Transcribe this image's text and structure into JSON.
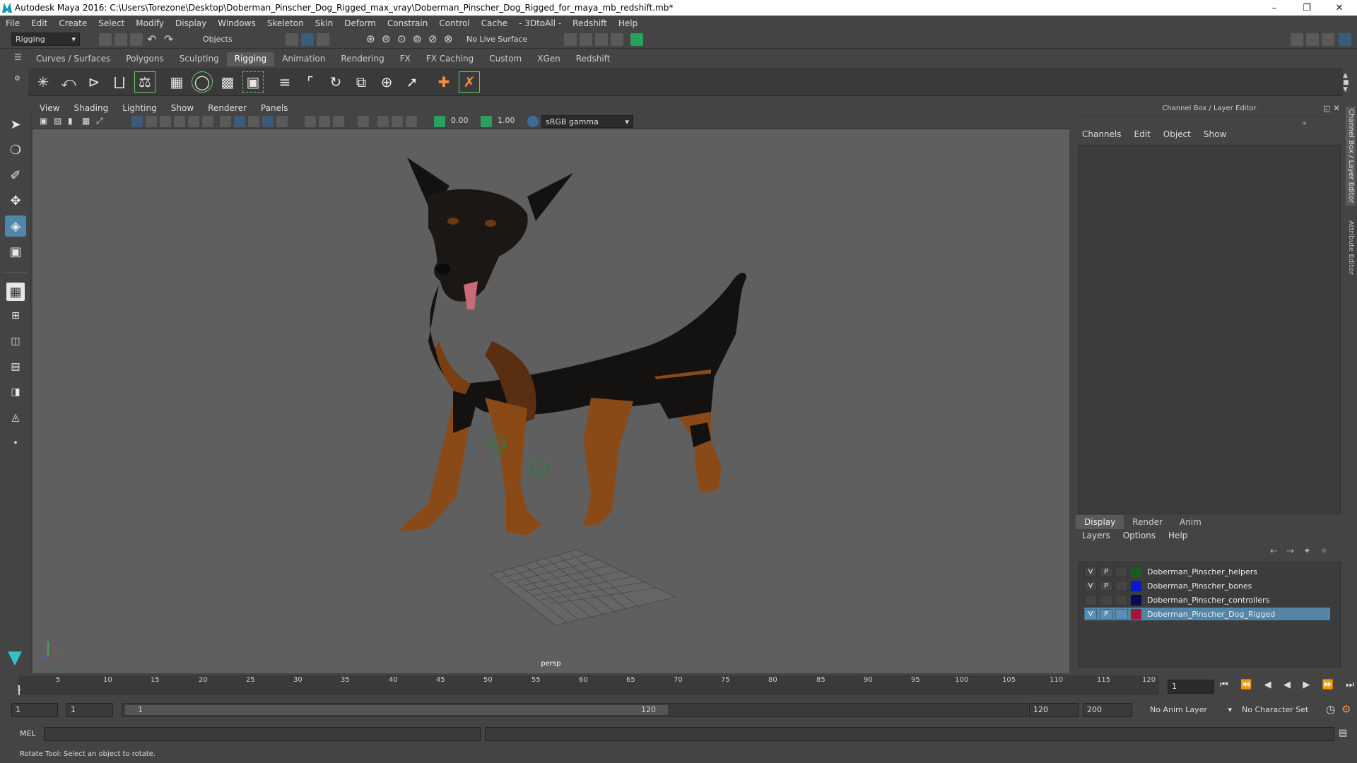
{
  "window": {
    "title": "Autodesk Maya 2016: C:\\Users\\Torezone\\Desktop\\Doberman_Pinscher_Dog_Rigged_max_vray\\Doberman_Pinscher_Dog_Rigged_for_maya_mb_redshift.mb*"
  },
  "menubar": [
    "File",
    "Edit",
    "Create",
    "Select",
    "Modify",
    "Display",
    "Windows",
    "Skeleton",
    "Skin",
    "Deform",
    "Constrain",
    "Control",
    "Cache",
    "- 3DtoAll -",
    "Redshift",
    "Help"
  ],
  "statusline": {
    "menuset": "Rigging",
    "selection_mode": "Objects",
    "live_surface": "No Live Surface"
  },
  "shelf": {
    "tabs": [
      "Curves / Surfaces",
      "Polygons",
      "Sculpting",
      "Rigging",
      "Animation",
      "Rendering",
      "FX",
      "FX Caching",
      "Custom",
      "XGen",
      "Redshift"
    ],
    "active_tab": "Rigging"
  },
  "viewport": {
    "menu": [
      "View",
      "Shading",
      "Lighting",
      "Show",
      "Renderer",
      "Panels"
    ],
    "exposure": "0.00",
    "gamma": "1.00",
    "colorspace": "sRGB gamma",
    "camera_label": "persp"
  },
  "channel_box": {
    "title": "Channel Box / Layer Editor",
    "menu": [
      "Channels",
      "Edit",
      "Object",
      "Show"
    ]
  },
  "layer_editor": {
    "tabs": [
      "Display",
      "Render",
      "Anim"
    ],
    "menu": [
      "Layers",
      "Options",
      "Help"
    ],
    "layers": [
      {
        "v": "V",
        "p": "P",
        "name": "Doberman_Pinscher_helpers",
        "color": "#1c5a24"
      },
      {
        "v": "V",
        "p": "P",
        "name": "Doberman_Pinscher_bones",
        "color": "#0a16d6"
      },
      {
        "v": "",
        "p": "",
        "name": "Doberman_Pinscher_controllers",
        "color": "#0a0a5a"
      },
      {
        "v": "V",
        "p": "P",
        "name": "Doberman_Pinscher_Dog_Rigged",
        "color": "#b01038"
      }
    ],
    "selected_layer": "Doberman_Pinscher_Dog_Rigged"
  },
  "side_tabs": [
    "Channel Box / Layer Editor",
    "Attribute Editor"
  ],
  "timeline": {
    "ticks": [
      "1",
      "5",
      "10",
      "15",
      "20",
      "25",
      "30",
      "35",
      "40",
      "45",
      "50",
      "55",
      "60",
      "65",
      "70",
      "75",
      "80",
      "85",
      "90",
      "95",
      "100",
      "105",
      "110",
      "115",
      "120"
    ],
    "current_frame": "1"
  },
  "range": {
    "start": "1",
    "playback_start": "1",
    "slider_start": "1",
    "slider_end": "120",
    "playback_end": "120",
    "end": "200",
    "anim_layer": "No Anim Layer",
    "character_set": "No Character Set"
  },
  "command_line": {
    "label": "MEL"
  },
  "help_line": "Rotate Tool: Select an object to rotate.",
  "colors": {
    "accent": "#5285a6",
    "bg": "#444444",
    "viewport": "#5f5f5f"
  }
}
